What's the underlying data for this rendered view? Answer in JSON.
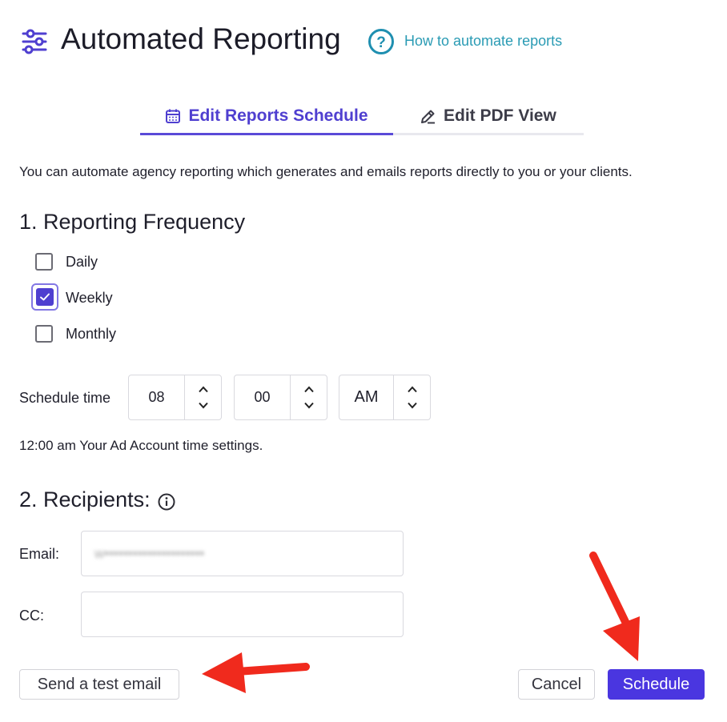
{
  "header": {
    "title": "Automated Reporting",
    "title_icon": "sliders-icon",
    "help_icon": "question-circle-icon",
    "help_link": "How to automate reports"
  },
  "tabs": [
    {
      "label": "Edit Reports Schedule",
      "icon": "calendar-icon",
      "active": true
    },
    {
      "label": "Edit PDF View",
      "icon": "pencil-icon",
      "active": false
    }
  ],
  "intro_text": "You can automate agency reporting which generates and emails reports directly to you or your clients.",
  "frequency": {
    "heading": "1. Reporting Frequency",
    "options": [
      {
        "label": "Daily",
        "checked": false
      },
      {
        "label": "Weekly",
        "checked": true
      },
      {
        "label": "Monthly",
        "checked": false
      }
    ]
  },
  "schedule": {
    "label": "Schedule time",
    "hour": "08",
    "minute": "00",
    "period": "AM",
    "tz_note": "12:00 am Your Ad Account time settings."
  },
  "recipients": {
    "heading": "2. Recipients:",
    "info_icon": "info-circle-icon",
    "email_label": "Email:",
    "email_value": "w•••••••••••••••••••••",
    "cc_label": "CC:",
    "cc_value": ""
  },
  "actions": {
    "test_email": "Send a test email",
    "cancel": "Cancel",
    "schedule": "Schedule"
  },
  "colors": {
    "accent": "#4f3fd0",
    "primary_button": "#4a36e0",
    "link": "#2a9bb4",
    "annotation_arrow": "#f02a1d"
  }
}
